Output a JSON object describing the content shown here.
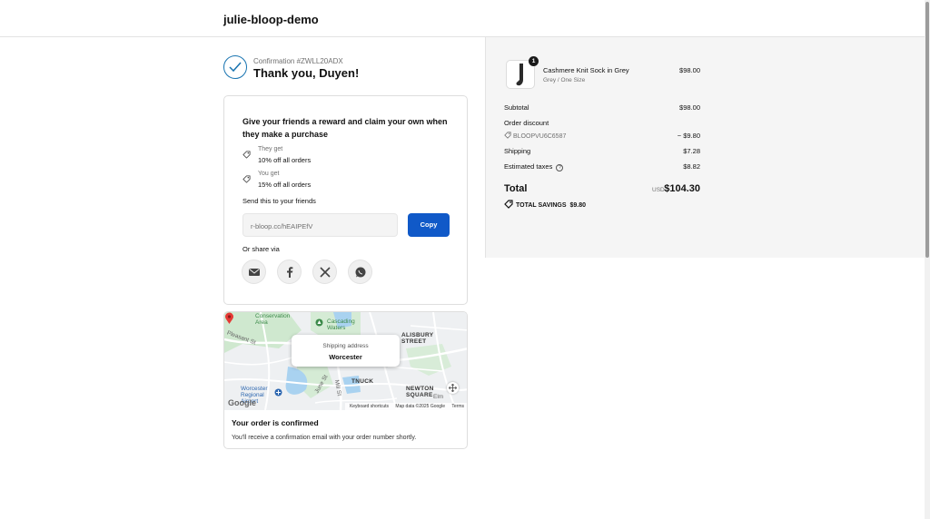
{
  "header": {
    "store_name": "julie-bloop-demo"
  },
  "confirmation": {
    "number_label": "Confirmation #ZWLL20ADX",
    "thank_you": "Thank you, Duyen!"
  },
  "referral": {
    "title": "Give your friends a reward and claim your own when they make a purchase",
    "perks": [
      {
        "label": "They get",
        "value": "10% off all orders",
        "icon": "tag-icon"
      },
      {
        "label": "You get",
        "value": "15% off all orders",
        "icon": "tag-icon"
      }
    ],
    "send_label": "Send this to your friends",
    "link": "r-bloop.cc/hEAIPEfV",
    "copy_label": "Copy",
    "share_label": "Or share via",
    "share_options": [
      "email-icon",
      "facebook-icon",
      "x-icon",
      "whatsapp-icon"
    ]
  },
  "map": {
    "labels": {
      "conservation": "Conservation\nArea",
      "cascading": "Cascading\nWaters",
      "salisbury": "ALISBURY\nSTREET",
      "worcester_airport": "Worcester\nRegional\nAirport",
      "newton": "NEWTON\nSQUARE",
      "elm": "Elm",
      "tnuck": "TNUCK",
      "pleasant": "Pleasant St",
      "mill": "Mill St",
      "june": "June St"
    },
    "popup_label": "Shipping address",
    "popup_value": "Worcester",
    "google": "Google",
    "attribution": [
      "Keyboard shortcuts",
      "Map data ©2025 Google",
      "Terms"
    ]
  },
  "order_status": {
    "title": "Your order is confirmed",
    "text": "You'll receive a confirmation email with your order number shortly."
  },
  "summary": {
    "product": {
      "name": "Cashmere Knit Sock in Grey",
      "variant": "Grey / One Size",
      "price": "$98.00",
      "quantity": "1"
    },
    "subtotal_label": "Subtotal",
    "subtotal": "$98.00",
    "discount_label": "Order discount",
    "discount_code": "BLOOPVU6C6587",
    "discount_value": "− $9.80",
    "shipping_label": "Shipping",
    "shipping": "$7.28",
    "taxes_label": "Estimated taxes",
    "taxes": "$8.82",
    "total_label": "Total",
    "currency": "USD",
    "total": "$104.30",
    "savings_label": "TOTAL SAVINGS",
    "savings": "$9.80"
  },
  "colors": {
    "accent": "#1059c8",
    "check": "#1773b0",
    "panel": "#f5f5f5"
  }
}
